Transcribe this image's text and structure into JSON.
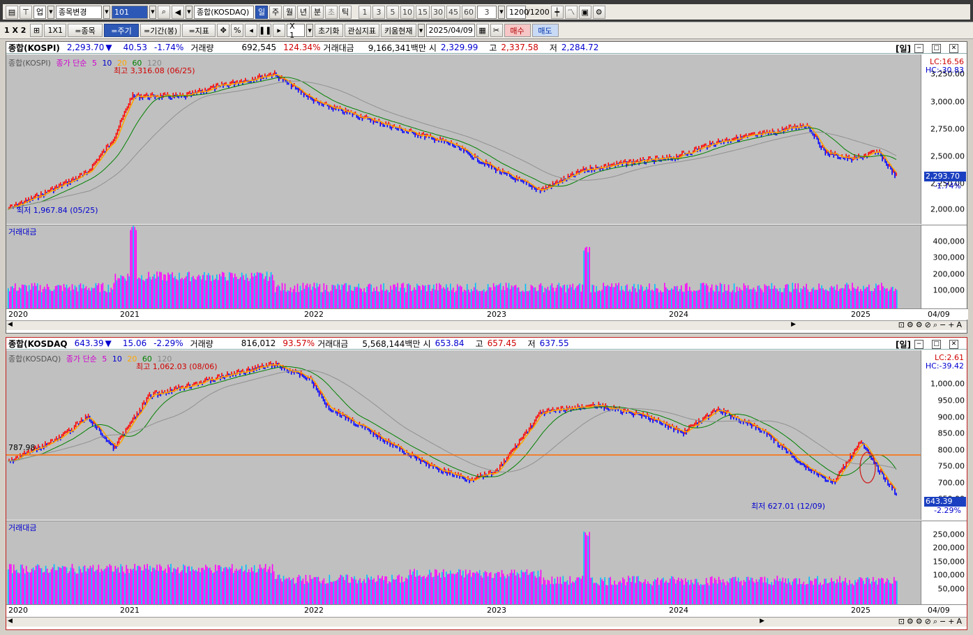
{
  "toolbar1": {
    "market_code": "업",
    "change_symbol": "종목변경",
    "symbol_input": "101",
    "audio_icon": "speaker-icon",
    "search_name": "종합(KOSDAQ)",
    "periods": [
      "일",
      "주",
      "월",
      "년",
      "분",
      "초",
      "틱"
    ],
    "numbers": [
      "1",
      "3",
      "5",
      "10",
      "15",
      "30",
      "45",
      "60"
    ],
    "custom_period": "3",
    "count": "1200",
    "count_max": "/1200"
  },
  "toolbar2": {
    "layout": "1 X 2",
    "layout2": "1X1",
    "item_btn": "=종목",
    "period_btn": "=주기",
    "range_btn": "=기간(봉)",
    "indicator_btn": "=지표",
    "percent": "%",
    "zoom": "X 1",
    "reset": "초기화",
    "interest": "관심지표",
    "kiwoom": "키움현재",
    "date": "2025/04/09",
    "buy": "매수",
    "sell": "매도"
  },
  "kospi": {
    "name": "종합(KOSPI)",
    "price": "2,293.70",
    "arrow": "▼",
    "change": "40.53",
    "rate": "-1.74%",
    "volume_label": "거래량",
    "volume": "692,545",
    "volume_rate": "124.34%",
    "amount_label": "거래대금",
    "amount": "9,166,341백만",
    "open_label": "시",
    "open": "2,329.99",
    "high_label": "고",
    "high": "2,337.58",
    "low_label": "저",
    "low": "2,284.72",
    "unit": "[일]",
    "legend": {
      "name": "종합(KOSPI)",
      "ma": "종가 단순",
      "ma5": "5",
      "ma10": "10",
      "ma20": "20",
      "ma60": "60",
      "ma120": "120"
    },
    "max_label": "최고 3,316.08 (06/25)",
    "min_label": "최저 1,967.84 (05/25)",
    "lc": "LC:16.56",
    "hc": "HC:-30.83",
    "price_tag": "2,293.70",
    "rate_tag": "-1.74%",
    "yticks": [
      "3,250.00",
      "3,000.00",
      "2,750.00",
      "2,500.00",
      "2,250.00",
      "2,000.00"
    ],
    "vol_title": "거래대금",
    "vol_ticks": [
      "400,000",
      "300,000",
      "200,000",
      "100,000"
    ]
  },
  "kosdaq": {
    "name": "종합(KOSDAQ",
    "price": "643.39",
    "arrow": "▼",
    "change": "15.06",
    "rate": "-2.29%",
    "volume_label": "거래량",
    "volume": "816,012",
    "volume_rate": "93.57%",
    "amount_label": "거래대금",
    "amount": "5,568,144백만",
    "open_label": "시",
    "open": "653.84",
    "high_label": "고",
    "high": "657.45",
    "low_label": "저",
    "low": "637.55",
    "unit": "[일]",
    "legend": {
      "name": "종합(KOSDAQ)",
      "ma": "종가 단순",
      "ma5": "5",
      "ma10": "10",
      "ma20": "20",
      "ma60": "60",
      "ma120": "120"
    },
    "max_label": "최고 1,062.03 (08/06)",
    "min_label": "최저 627.01 (12/09)",
    "lc": "LC:2.61",
    "hc": "HC:-39.42",
    "price_tag": "643.39",
    "rate_tag": "-2.29%",
    "hline_label": "787.98",
    "yticks": [
      "1,000.00",
      "950.00",
      "900.00",
      "850.00",
      "800.00",
      "750.00",
      "700.00",
      "650.00"
    ],
    "vol_title": "거래대금",
    "vol_ticks": [
      "250,000",
      "200,000",
      "150,000",
      "100,000",
      "50,000"
    ]
  },
  "xaxis": [
    "2020",
    "2021",
    "2022",
    "2023",
    "2024",
    "2025",
    "04/09"
  ],
  "colors": {
    "up": "#ff0000",
    "down": "#0000ff",
    "ma5": "#ffa500",
    "ma20": "#008000",
    "ma60": "#909090",
    "hline": "#ff6a00",
    "vol_a": "#ff00ff",
    "vol_b": "#00bfff"
  }
}
